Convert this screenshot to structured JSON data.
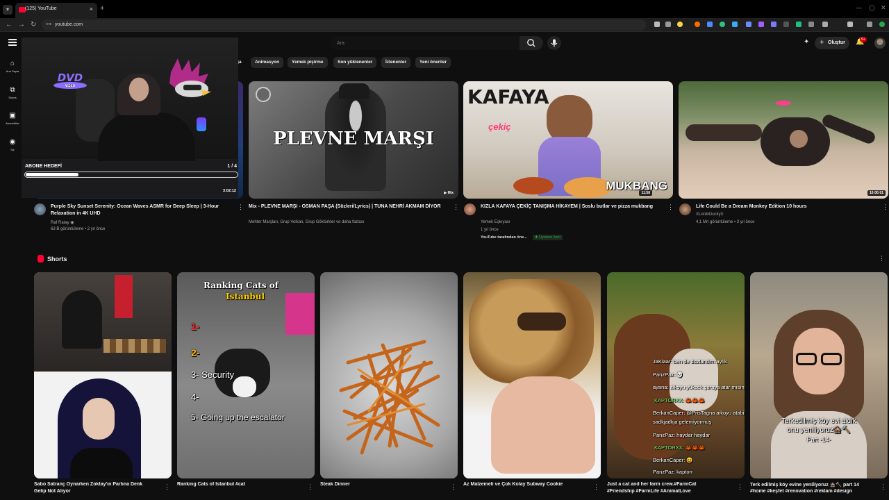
{
  "browser": {
    "tab_title": "(125) YouTube",
    "url": "youtube.com"
  },
  "masthead": {
    "search_placeholder": "Ara",
    "create_label": "Oluştur",
    "notification_count": "9+"
  },
  "guide": [
    {
      "label": "Ana Sayfa",
      "icon": "home-icon"
    },
    {
      "label": "Shorts",
      "icon": "shorts-icon"
    },
    {
      "label": "Abonelikler",
      "icon": "subscriptions-icon"
    },
    {
      "label": "Siz",
      "icon": "you-icon"
    }
  ],
  "chips": [
    "ğa",
    "Animasyon",
    "Yemek pişirme",
    "Son yüklenenler",
    "İzlenenler",
    "Yeni öneriler"
  ],
  "pip": {
    "dvd_text": "DVD",
    "dvd_sub": "VIDEO",
    "goal_label": "ABONE HEDEFİ",
    "goal_count": "1 / 4",
    "goal_progress": 0.25,
    "duration": "3:02:12"
  },
  "videos": [
    {
      "title": "Purple Sky Sunset Serenity: Ocean Waves ASMR for Deep Sleep | 3-Hour Relaxation in 4K UHD",
      "channel": "Raf Ratay",
      "meta": "63 B görüntüleme • 2 yıl önce",
      "duration": "3:02:12"
    },
    {
      "title": "Mix - PLEVNE MARŞI - OSMAN PAŞA (Sözleri/Lyrics) | TUNA NEHRİ AKMAM DİYOR",
      "channel": "Mehter Marşları, Grup Volkan, Grup Göktürkler ve daha fazlası",
      "thumb_text": "PLEVNE MARŞI",
      "badge": "Mix"
    },
    {
      "title": "KIZLA KAFAYA ÇEKİÇ TANIŞMA HİKAYEM | Soslu butlar ve pizza mukbang",
      "channel": "Yemek Eşkıyası",
      "meta": "1 yıl önce",
      "extra_note": "YouTube tarafından öne...",
      "members_badge": "Üyelere özel",
      "thumb_text": "KAFAYA",
      "thumb_text2": "çekiç",
      "thumb_text3": "MUKBANG",
      "duration": "11:58"
    },
    {
      "title": "Life Could Be a Dream Monkey Edition 10 hours",
      "channel": "XLordxDuckyX",
      "meta": "4,1 Mn görüntüleme • 3 yıl önce",
      "duration": "10:00:01"
    }
  ],
  "shorts_shelf": {
    "title": "Shorts",
    "items": [
      {
        "title": "Sabo Satranç Oynarken Zoktay'ın Partına Denk",
        "title2": "Gelip Not Alıyor"
      },
      {
        "title": "Ranking Cats of Istanbul #cat",
        "overlay_title": "Ranking Cats of",
        "overlay_title2": "Istanbul",
        "ranks": [
          "1-",
          "2-",
          "3- Security",
          "4-",
          "5- Going up the escalator"
        ]
      },
      {
        "title": "Steak Dinner"
      },
      {
        "title": "Az Malzemeli ve Çok Kolay Subway Cookie"
      },
      {
        "title": "Just a cat and her farm crew.#FarmCat",
        "title2": "#Friendship #FarmLife #AnimalLove",
        "chat": [
          "JaKlaar: ben de dozlandım aylık",
          "PanzPaz: 💀",
          "ayana: aikoyu yüksek şuraya atar mısın agabey",
          "KAPTORXX: 🦀🦀🦀",
          "BerkanCaper: @PrisTagna aikoyu atabilcen mi bizim oraya",
          "sadkjadkja gelemiyormuş",
          "PanzPaz: haydar haydar",
          "KAPTORXX: 🦀🦀🦀",
          "BerkanCaper: 😆",
          "PanzPaz: kaptorr"
        ]
      },
      {
        "title": "Terk edilmiş köy evine yeniliyoruz 🏚️🔨 part 14",
        "title2": "#home #keşfet #renovation #reklam #design",
        "overlay1": "Terkedilmiş köy evi aldık",
        "overlay2": "onu yeniliyoruz🏚️🔨",
        "overlay3": "Part -14-"
      }
    ]
  },
  "colors": {
    "background": "#0f0f0f",
    "chip": "#272727",
    "brand_red": "#ff0033",
    "chat_green": "#6cf56c"
  }
}
